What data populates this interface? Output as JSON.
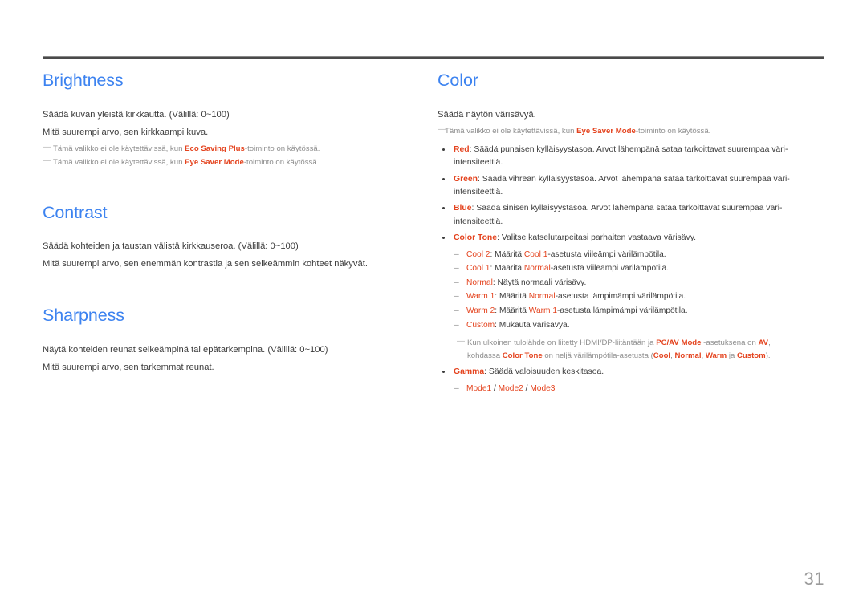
{
  "page": {
    "number": "31",
    "language": "fi"
  },
  "left_column": {
    "sections": [
      {
        "title": "Brightness",
        "lines": [
          "Säädä kuvan yleistä kirkkautta. (Välillä: 0~100)",
          "Mitä suurempi arvo, sen kirkkaampi kuva."
        ],
        "notes": [
          {
            "prefix": "Tämä valikko ei ole käytettävissä, kun ",
            "accent": "Eco Saving Plus",
            "suffix": "-toiminto on käytössä."
          },
          {
            "prefix": "Tämä valikko ei ole käytettävissä, kun ",
            "accent": "Eye Saver Mode",
            "suffix": "-toiminto on käytössä."
          }
        ]
      },
      {
        "title": "Contrast",
        "lines": [
          "Säädä kohteiden ja taustan välistä kirkkauseroa. (Välillä: 0~100)",
          "Mitä suurempi arvo, sen enemmän kontrastia ja sen selkeämmin kohteet näkyvät."
        ]
      },
      {
        "title": "Sharpness",
        "lines": [
          "Näytä kohteiden reunat selkeämpinä tai epätarkempina. (Välillä: 0~100)",
          "Mitä suurempi arvo, sen tarkemmat reunat."
        ]
      }
    ]
  },
  "right_column": {
    "title": "Color",
    "intro": "Säädä näytön värisävyä.",
    "intro_note": {
      "prefix": "Tämä valikko ei ole käytettävissä, kun ",
      "accent": "Eye Saver Mode",
      "suffix": "-toiminto on käytössä."
    },
    "bullets": [
      {
        "term": "Red",
        "text": ": Säädä punaisen kylläisyystasoa. Arvot lähempänä sataa tarkoittavat suurempaa väri-intensiteettiä."
      },
      {
        "term": "Green",
        "text": ": Säädä vihreän kylläisyystasoa. Arvot lähempänä sataa tarkoittavat suurempaa väri-intensiteettiä."
      },
      {
        "term": "Blue",
        "text": ": Säädä sinisen kylläisyystasoa. Arvot lähempänä sataa tarkoittavat suurempaa väri-intensiteettiä."
      },
      {
        "term": "Color Tone",
        "text": ": Valitse katselutarpeitasi parhaiten vastaava värisävy."
      }
    ],
    "color_tone_items": [
      {
        "term": "Cool 2",
        "mid": ": Määritä ",
        "ref": "Cool 1",
        "tail": "-asetusta viileämpi värilämpötila."
      },
      {
        "term": "Cool 1",
        "mid": ": Määritä ",
        "ref": "Normal",
        "tail": "-asetusta viileämpi värilämpötila."
      },
      {
        "term": "Normal",
        "mid": ": Näytä normaali värisävy.",
        "ref": "",
        "tail": ""
      },
      {
        "term": "Warm 1",
        "mid": ": Määritä ",
        "ref": "Normal",
        "tail": "-asetusta lämpimämpi värilämpötila."
      },
      {
        "term": "Warm 2",
        "mid": ": Määritä ",
        "ref": "Warm 1",
        "tail": "-asetusta lämpimämpi värilämpötila."
      },
      {
        "term": "Custom",
        "mid": ": Mukauta värisävyä.",
        "ref": "",
        "tail": ""
      }
    ],
    "av_note": {
      "part1": "Kun ulkoinen tulolähde on liitetty HDMI/DP-liitäntään ja ",
      "accent1": "PC/AV Mode",
      "part2": " -asetuksena on ",
      "accent2": "AV",
      "part3": ", kohdassa ",
      "accent3": "Color Tone",
      "part4": " on neljä värilämpötila-asetusta (",
      "accent4": "Cool",
      "sep1": ", ",
      "accent5": "Normal",
      "sep2": ", ",
      "accent6": "Warm",
      "sep3": " ja ",
      "accent7": "Custom",
      "part5": ")."
    },
    "gamma": {
      "term": "Gamma",
      "text": ": Säädä valoisuuden keskitasoa.",
      "modes": [
        "Mode1",
        "Mode2",
        "Mode3"
      ],
      "separator": " / "
    }
  }
}
